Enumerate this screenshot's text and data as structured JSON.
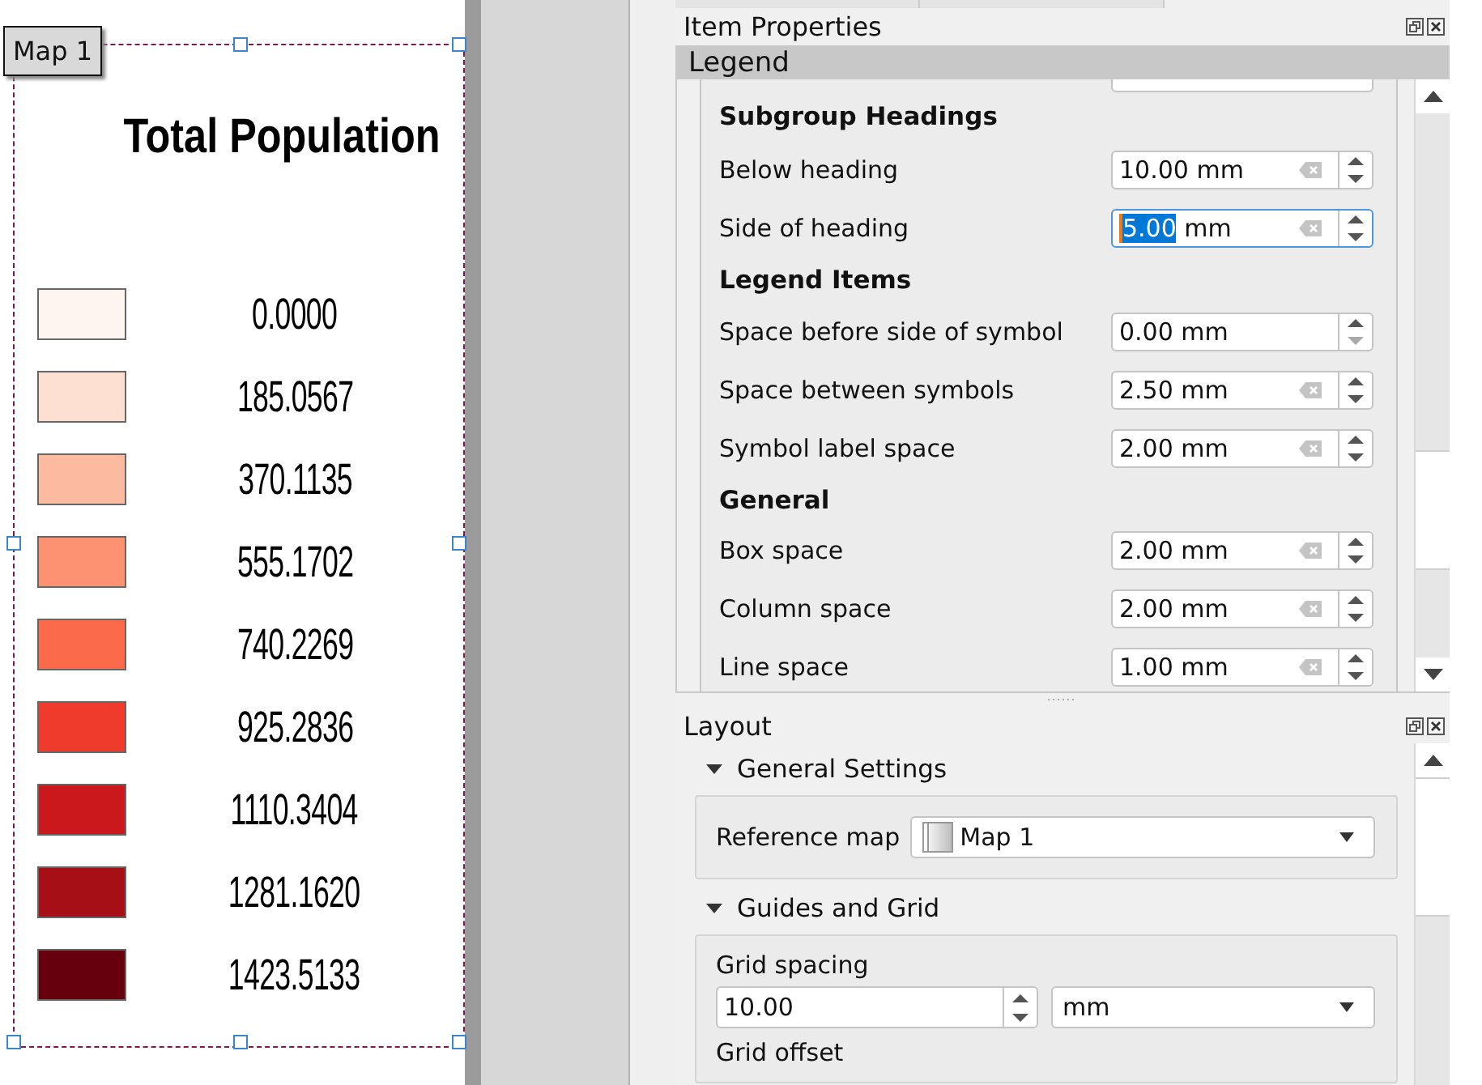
{
  "canvas": {
    "item_label": "Map 1",
    "legend": {
      "title": "Total Population",
      "items": [
        {
          "label": "0.0000",
          "color": "#fff5f0"
        },
        {
          "label": "185.0567",
          "color": "#fee0d2"
        },
        {
          "label": "370.1135",
          "color": "#fcbba1"
        },
        {
          "label": "555.1702",
          "color": "#fc9272"
        },
        {
          "label": "740.2269",
          "color": "#fb6a4a"
        },
        {
          "label": "925.2836",
          "color": "#ef3b2c"
        },
        {
          "label": "1110.3404",
          "color": "#cb181d"
        },
        {
          "label": "1281.1620",
          "color": "#a50f15"
        },
        {
          "label": "1423.5133",
          "color": "#67000d"
        }
      ]
    }
  },
  "item_properties": {
    "title": "Item Properties",
    "section": "Legend",
    "groups": [
      {
        "heading": "Subgroup Headings",
        "fields": [
          {
            "label": "Below heading",
            "value": "10.00",
            "unit": "mm",
            "clearable": true,
            "focused": false
          },
          {
            "label": "Side of heading",
            "value": "5.00",
            "unit": "mm",
            "clearable": true,
            "focused": true
          }
        ]
      },
      {
        "heading": "Legend Items",
        "fields": [
          {
            "label": "Space before side of symbol",
            "value": "0.00",
            "unit": "mm",
            "clearable": false,
            "focused": false
          },
          {
            "label": "Space between symbols",
            "value": "2.50",
            "unit": "mm",
            "clearable": true,
            "focused": false
          },
          {
            "label": "Symbol label space",
            "value": "2.00",
            "unit": "mm",
            "clearable": true,
            "focused": false
          }
        ]
      },
      {
        "heading": "General",
        "fields": [
          {
            "label": "Box space",
            "value": "2.00",
            "unit": "mm",
            "clearable": true,
            "focused": false
          },
          {
            "label": "Column space",
            "value": "2.00",
            "unit": "mm",
            "clearable": true,
            "focused": false
          },
          {
            "label": "Line space",
            "value": "1.00",
            "unit": "mm",
            "clearable": true,
            "focused": false
          }
        ]
      }
    ]
  },
  "layout": {
    "title": "Layout",
    "sections": [
      {
        "title": "General Settings",
        "expanded": true,
        "rows": [
          {
            "kind": "combo",
            "label": "Reference map",
            "value": "Map 1"
          }
        ]
      },
      {
        "title": "Guides and Grid",
        "expanded": true,
        "rows": [
          {
            "kind": "spin",
            "label": "Grid spacing",
            "value": "10.00",
            "unit": "mm"
          },
          {
            "kind": "label",
            "label": "Grid offset"
          }
        ]
      }
    ]
  }
}
